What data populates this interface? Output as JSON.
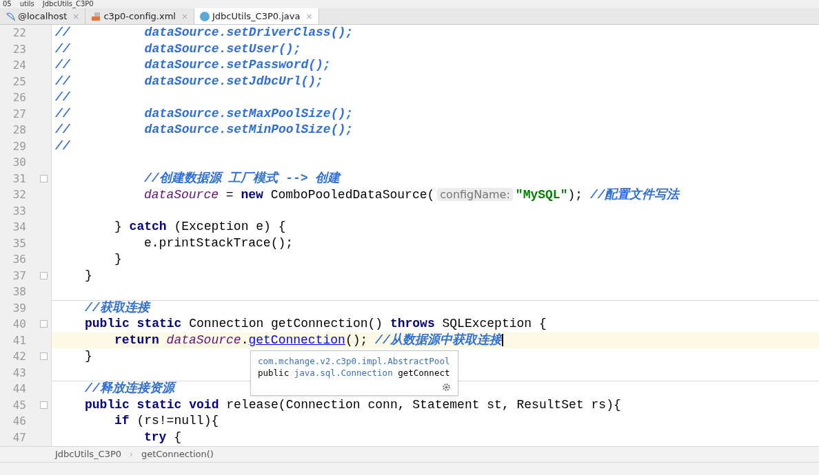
{
  "path": [
    "05",
    "utils",
    "JdbcUtils_C3P0"
  ],
  "tabs": [
    {
      "label": "@localhost",
      "kind": "database",
      "selected": false,
      "close": "×"
    },
    {
      "label": "c3p0-config.xml",
      "kind": "xml",
      "selected": false,
      "close": "×"
    },
    {
      "label": "JdbcUtils_C3P0.java",
      "kind": "class",
      "selected": true,
      "close": "×"
    }
  ],
  "editor": {
    "lines": [
      {
        "number": "22",
        "tokens": [
          {
            "t": "//          dataSource.setDriverClass();",
            "kind": "comment"
          }
        ]
      },
      {
        "number": "23",
        "tokens": [
          {
            "t": "//          dataSource.setUser();",
            "kind": "comment"
          }
        ]
      },
      {
        "number": "24",
        "tokens": [
          {
            "t": "//          dataSource.setPassword();",
            "kind": "comment"
          }
        ]
      },
      {
        "number": "25",
        "tokens": [
          {
            "t": "//          dataSource.setJdbcUrl();",
            "kind": "comment"
          }
        ]
      },
      {
        "number": "26",
        "tokens": [
          {
            "t": "//",
            "kind": "comment"
          }
        ]
      },
      {
        "number": "27",
        "tokens": [
          {
            "t": "//          dataSource.setMaxPoolSize();",
            "kind": "comment"
          }
        ]
      },
      {
        "number": "28",
        "tokens": [
          {
            "t": "//          dataSource.setMinPoolSize();",
            "kind": "comment"
          }
        ]
      },
      {
        "number": "29",
        "tokens": [
          {
            "t": "//",
            "kind": "comment"
          }
        ]
      },
      {
        "number": "30"
      },
      {
        "number": "31",
        "fold": true,
        "kind": "nested",
        "tokens": [
          {
            "t": "//创建数据源 工厂模式 --> 创建",
            "kind": "comment"
          }
        ]
      },
      {
        "number": "32",
        "kind": "nested",
        "tokens": [
          {
            "t": "dataSource",
            "kind": "field"
          },
          {
            "t": " = ",
            "kind": "plain"
          },
          {
            "t": "new",
            "kind": "keyword"
          },
          {
            "t": " ComboPooledDataSource(",
            "kind": "plain"
          },
          {
            "t": "configName:",
            "kind": "hint"
          },
          {
            "t": "\"MySQL\"",
            "kind": "string"
          },
          {
            "t": "); ",
            "kind": "plain"
          },
          {
            "t": "//配置文件写法",
            "kind": "comment"
          }
        ]
      },
      {
        "number": "33"
      },
      {
        "number": "34",
        "kind": "statement",
        "tokens": [
          {
            "t": "} ",
            "kind": "plain"
          },
          {
            "t": "catch",
            "kind": "keyword"
          },
          {
            "t": " (Exception e) {",
            "kind": "plain"
          }
        ]
      },
      {
        "number": "35",
        "kind": "nested",
        "tokens": [
          {
            "t": "e.printStackTrace();",
            "kind": "plain"
          }
        ]
      },
      {
        "number": "36",
        "kind": "statement",
        "tokens": [
          {
            "t": "}",
            "kind": "plain"
          }
        ]
      },
      {
        "number": "37",
        "fold": true,
        "kind": "member",
        "tokens": [
          {
            "t": "}",
            "kind": "plain"
          }
        ]
      },
      {
        "number": "38"
      },
      {
        "number": "39",
        "separator": true,
        "kind": "member",
        "tokens": [
          {
            "t": "//获取连接",
            "kind": "comment"
          }
        ]
      },
      {
        "number": "40",
        "fold": true,
        "kind": "member",
        "tokens": [
          {
            "t": "public static",
            "kind": "keyword"
          },
          {
            "t": " Connection getConnection() ",
            "kind": "plain"
          },
          {
            "t": "throws",
            "kind": "keyword"
          },
          {
            "t": " SQLException {",
            "kind": "plain"
          }
        ]
      },
      {
        "number": "41",
        "current": true,
        "kind": "statement",
        "tokens": [
          {
            "t": "return",
            "kind": "keyword"
          },
          {
            "t": " dataSource",
            "kind": "field"
          },
          {
            "t": ".",
            "kind": "plain"
          },
          {
            "t": "getConnection",
            "kind": "link"
          },
          {
            "t": "(); ",
            "kind": "plain"
          },
          {
            "t": "//从数据源中获取连接",
            "kind": "comment"
          }
        ]
      },
      {
        "number": "42",
        "fold": true,
        "kind": "member",
        "tokens": [
          {
            "t": "}",
            "kind": "plain"
          }
        ]
      },
      {
        "number": "43"
      },
      {
        "number": "44",
        "separator": true,
        "kind": "member",
        "tokens": [
          {
            "t": "//释放连接资源",
            "kind": "comment"
          }
        ]
      },
      {
        "number": "45",
        "fold": true,
        "kind": "member",
        "tokens": [
          {
            "t": "public static void",
            "kind": "keyword"
          },
          {
            "t": " release(Connection conn, Statement st, ResultSet rs){",
            "kind": "plain"
          }
        ]
      },
      {
        "number": "46",
        "kind": "statement",
        "tokens": [
          {
            "t": "if",
            "kind": "keyword"
          },
          {
            "t": " (rs!=null){",
            "kind": "plain"
          }
        ]
      },
      {
        "number": "47",
        "kind": "nested",
        "tokens": [
          {
            "t": "try",
            "kind": "keyword"
          },
          {
            "t": " {",
            "kind": "plain"
          }
        ]
      }
    ]
  },
  "doc_popup": {
    "package": "com.mchange.v2.c3p0.impl.AbstractPool",
    "signature": [
      {
        "t": "public ",
        "kind": "plain"
      },
      {
        "t": "java.sql.Connection",
        "kind": "type"
      },
      {
        "t": " getConnect",
        "kind": "plain"
      }
    ]
  },
  "breadcrumbs": {
    "items": [
      "JdbcUtils_C3P0",
      "getConnection()"
    ],
    "separator": "›"
  }
}
